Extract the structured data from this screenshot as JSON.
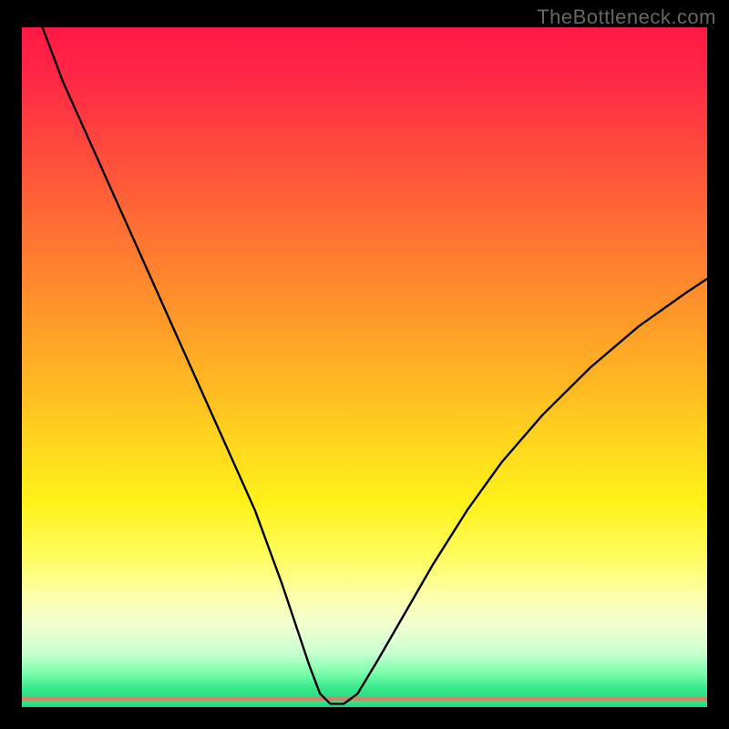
{
  "watermark": "TheBottleneck.com",
  "chart_data": {
    "type": "line",
    "title": "",
    "xlabel": "",
    "ylabel": "",
    "xlim": [
      0,
      100
    ],
    "ylim": [
      0,
      100
    ],
    "series": [
      {
        "name": "curve",
        "x": [
          3,
          6,
          10,
          14,
          18,
          22,
          26,
          30,
          34,
          38,
          40,
          42,
          43.5,
          45,
          47,
          49,
          52,
          56,
          60,
          65,
          70,
          76,
          83,
          90,
          97,
          100
        ],
        "values": [
          100,
          92,
          83,
          74,
          65,
          56,
          47,
          38,
          29,
          18,
          12,
          6,
          2,
          0.5,
          0.5,
          2,
          7,
          14,
          21,
          29,
          36,
          43,
          50,
          56,
          61,
          63
        ]
      }
    ],
    "notch": {
      "x": 46,
      "width": 3
    },
    "gradient_stops": [
      {
        "pos": 0.0,
        "color": "#ff1946"
      },
      {
        "pos": 0.5,
        "color": "#ffb024"
      },
      {
        "pos": 0.78,
        "color": "#fffc60"
      },
      {
        "pos": 0.95,
        "color": "#7affac"
      },
      {
        "pos": 0.988,
        "color": "#ff6a5a"
      },
      {
        "pos": 1.0,
        "color": "#1fd37a"
      }
    ]
  }
}
